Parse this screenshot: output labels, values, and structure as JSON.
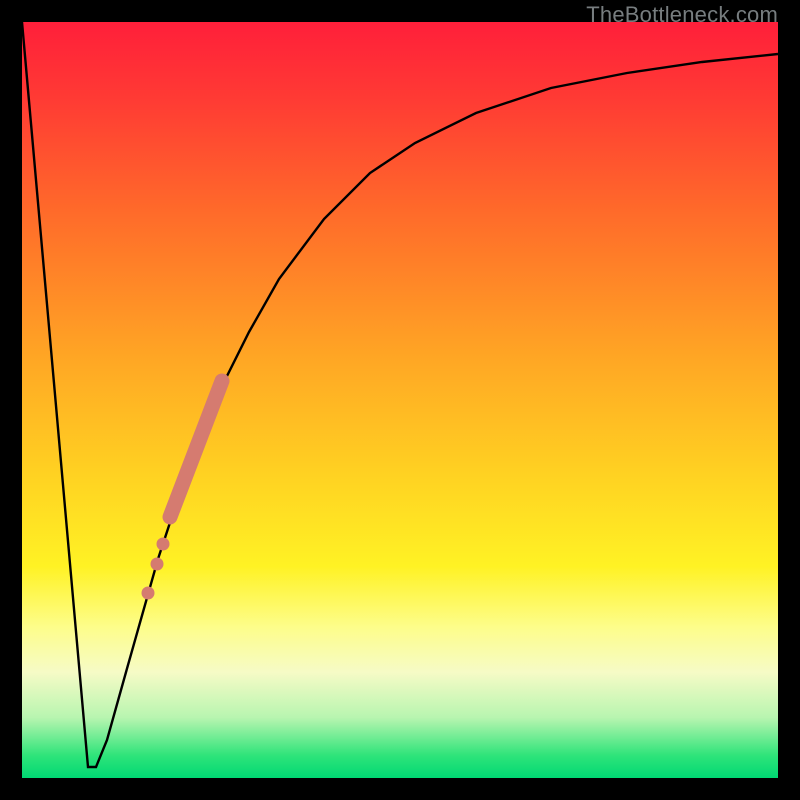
{
  "watermark": "TheBottleneck.com",
  "chart_data": {
    "type": "line",
    "title": "",
    "xlabel": "",
    "ylabel": "",
    "xlim": [
      0,
      1
    ],
    "ylim": [
      0,
      1
    ],
    "grid": false,
    "legend": false,
    "background_gradient": {
      "direction": "top-to-bottom",
      "stops": [
        {
          "pos": 0.0,
          "color": "#ff1f3a"
        },
        {
          "pos": 0.25,
          "color": "#ff6a2a"
        },
        {
          "pos": 0.5,
          "color": "#ffc423"
        },
        {
          "pos": 0.75,
          "color": "#fff64a"
        },
        {
          "pos": 0.92,
          "color": "#b8f5b0"
        },
        {
          "pos": 1.0,
          "color": "#00d873"
        }
      ]
    },
    "series": [
      {
        "name": "bottleneck-curve",
        "color": "#000000",
        "x": [
          0.0,
          0.088,
          0.098,
          0.112,
          0.14,
          0.18,
          0.22,
          0.26,
          0.3,
          0.34,
          0.4,
          0.46,
          0.52,
          0.6,
          0.7,
          0.8,
          0.9,
          1.0
        ],
        "y": [
          1.0,
          0.015,
          0.015,
          0.05,
          0.15,
          0.29,
          0.41,
          0.51,
          0.59,
          0.66,
          0.74,
          0.8,
          0.84,
          0.88,
          0.912,
          0.932,
          0.947,
          0.958
        ]
      }
    ],
    "highlight_band": {
      "name": "highlight-band",
      "color": "#d57b70",
      "thin_points": [
        {
          "x": 0.167,
          "y": 0.245
        },
        {
          "x": 0.178,
          "y": 0.283
        },
        {
          "x": 0.186,
          "y": 0.31
        }
      ],
      "thick_segment": {
        "start": {
          "x": 0.196,
          "y": 0.345
        },
        "end": {
          "x": 0.265,
          "y": 0.525
        }
      }
    }
  }
}
